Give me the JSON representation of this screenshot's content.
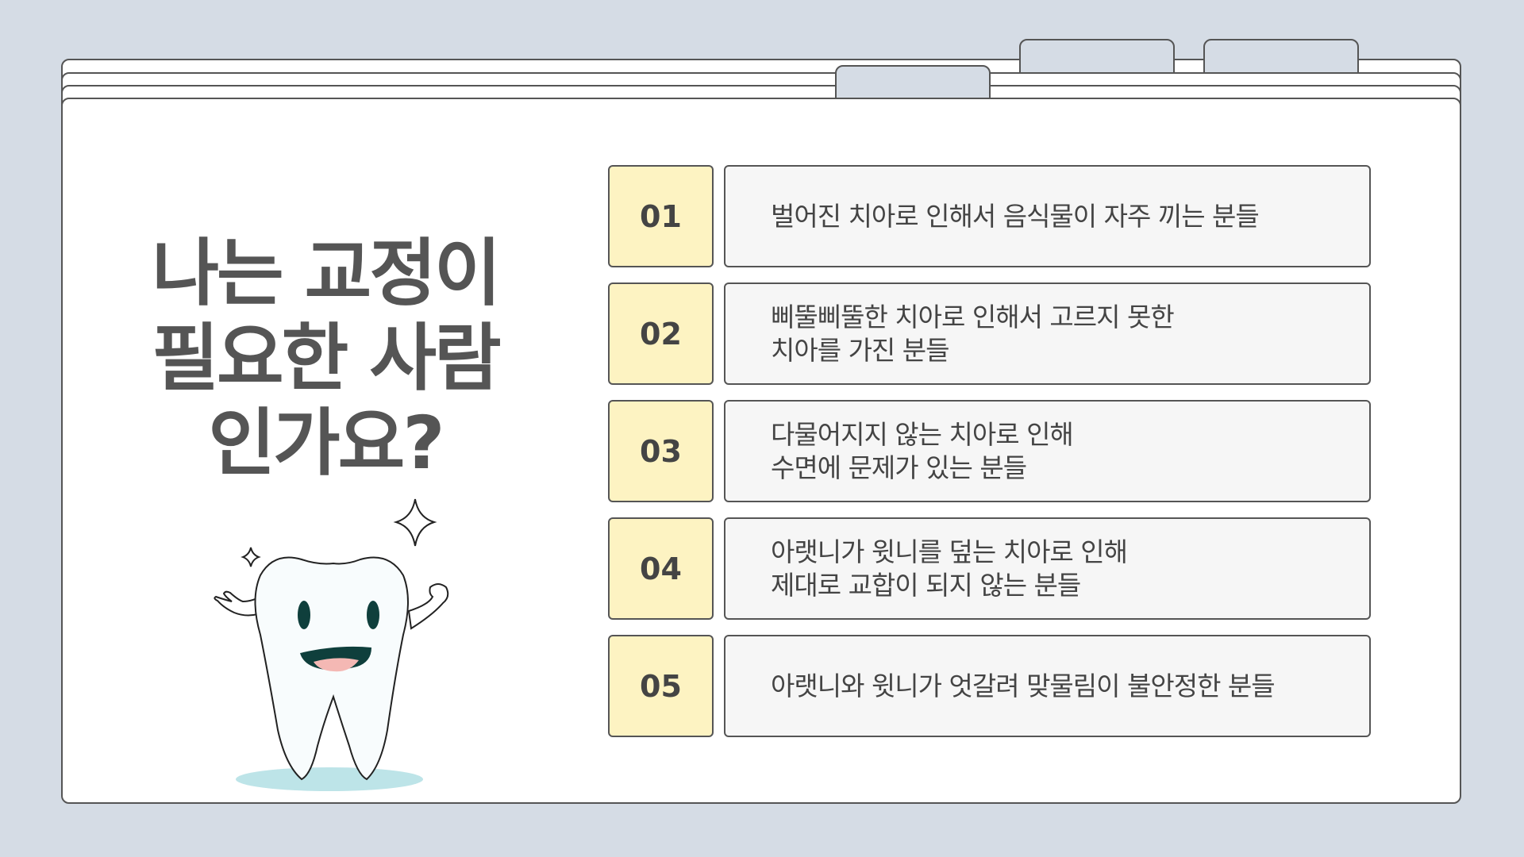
{
  "title": {
    "line1": "나는 교정이",
    "line2": "필요한 사람",
    "line3": "인가요?"
  },
  "items": [
    {
      "number": "01",
      "lines": [
        "벌어진 치아로 인해서 음식물이 자주 끼는 분들"
      ]
    },
    {
      "number": "02",
      "lines": [
        "삐뚤삐뚤한 치아로 인해서 고르지 못한",
        "치아를 가진 분들"
      ]
    },
    {
      "number": "03",
      "lines": [
        "다물어지지 않는 치아로 인해",
        "수면에 문제가 있는 분들"
      ]
    },
    {
      "number": "04",
      "lines": [
        "아랫니가 윗니를 덮는 치아로 인해",
        "제대로 교합이 되지 않는 분들"
      ]
    },
    {
      "number": "05",
      "lines": [
        "아랫니와 윗니가 엇갈려 맞물림이 불안정한 분들"
      ]
    }
  ],
  "colors": {
    "background": "#d5dce5",
    "number_box": "#fdf3c2",
    "text_box": "#f6f6f6",
    "title_text": "#555555"
  },
  "icons": [
    "tooth-mascot-illustration",
    "sparkle-icon"
  ]
}
